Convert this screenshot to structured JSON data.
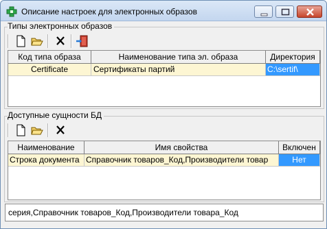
{
  "window": {
    "title": "Описание настроек для электронных образов",
    "icon": "green-cross-icon",
    "controls": {
      "minimize": "minimize-icon",
      "maximize": "maximize-icon",
      "close": "close-icon"
    }
  },
  "types_group": {
    "title": "Типы электронных образов",
    "toolbar": [
      "new-document-icon",
      "open-folder-icon",
      "delete-x-icon",
      "exit-door-icon"
    ],
    "columns": [
      "Код типа образа",
      "Наименование типа эл. образа",
      "Директория"
    ],
    "rows": [
      {
        "code": "Certificate",
        "name": "Сертификаты партий",
        "directory": "C:\\sertif\\"
      }
    ]
  },
  "entities_group": {
    "title": "Доступные сущности БД",
    "toolbar": [
      "new-document-icon",
      "open-folder-icon",
      "delete-x-icon"
    ],
    "columns": [
      "Наименование",
      "Имя свойства",
      "Включен"
    ],
    "rows": [
      {
        "name": "Строка документа",
        "property": "Справочник товаров_Код,Производители товар",
        "enabled": "Нет"
      }
    ]
  },
  "status_text": "серия,Справочник товаров_Код,Производители товара_Код",
  "colors": {
    "selection": "#3399ff",
    "row_highlight": "#fdf6d3",
    "window_bg": "#f0f0f0"
  }
}
